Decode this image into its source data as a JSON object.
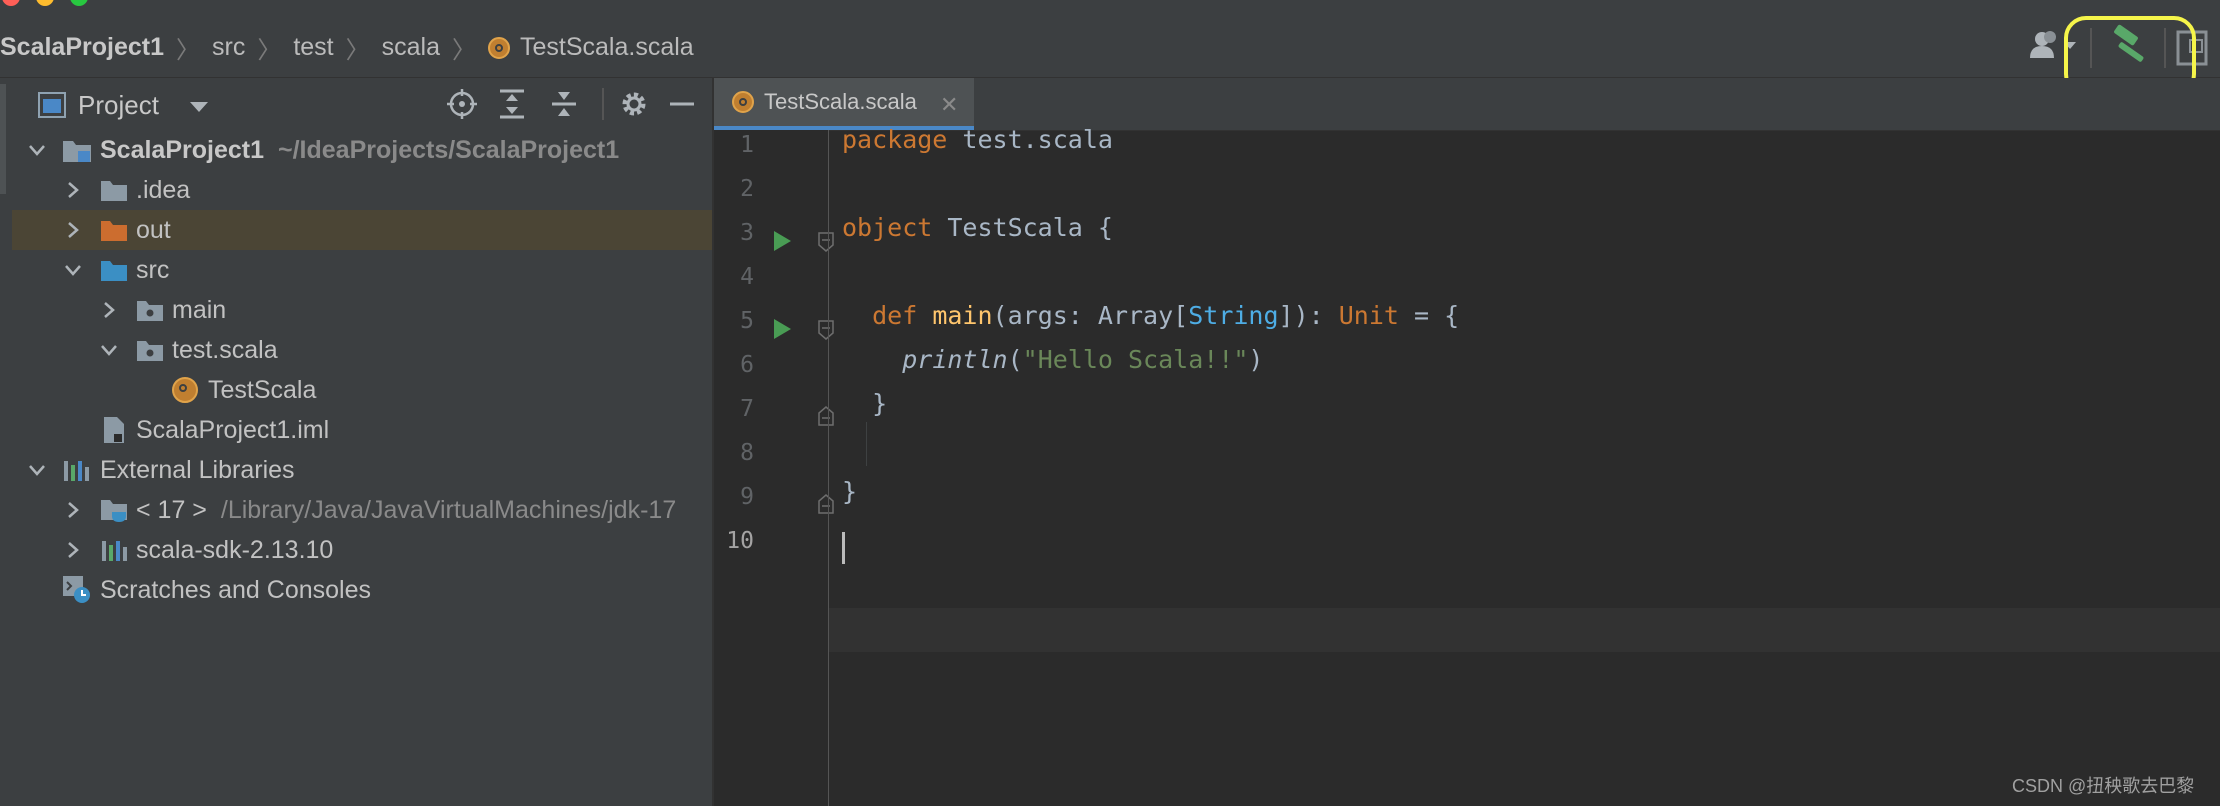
{
  "window": {
    "breadcrumb": [
      "ScalaProject1",
      "src",
      "test",
      "scala",
      "TestScala.scala"
    ]
  },
  "colors": {
    "highlight_ring": "#f6f54a",
    "build_hammer": "#59a869",
    "run_arrow": "#499c54",
    "selected_row": "#4b4535",
    "scala_icon": "#c07f30"
  },
  "project_panel": {
    "title": "Project",
    "header_icons": [
      "locate-icon",
      "expand-all-icon",
      "collapse-all-icon",
      "gear-icon",
      "minimize-icon"
    ],
    "tree": [
      {
        "label": "ScalaProject1",
        "path": "~/IdeaProjects/ScalaProject1"
      },
      {
        "label": ".idea"
      },
      {
        "label": "out"
      },
      {
        "label": "src"
      },
      {
        "label": "main"
      },
      {
        "label": "test.scala"
      },
      {
        "label": "TestScala"
      },
      {
        "label": "ScalaProject1.iml"
      },
      {
        "label": "External Libraries"
      },
      {
        "label": "< 17 >",
        "path": "/Library/Java/JavaVirtualMachines/jdk-17"
      },
      {
        "label": "scala-sdk-2.13.10"
      },
      {
        "label": "Scratches and Consoles"
      }
    ]
  },
  "editor": {
    "tab_label": "TestScala.scala",
    "line_numbers": [
      "1",
      "2",
      "3",
      "4",
      "5",
      "6",
      "7",
      "8",
      "9",
      "10"
    ],
    "code": {
      "l1_kw": "package",
      "l1_rest": " test.scala",
      "l3_kw": "object",
      "l3_rest": " TestScala {",
      "l5_indent": "  ",
      "l5_kw": "def",
      "l5_sp": " ",
      "l5_fn": "main",
      "l5_a": "(args: Array[",
      "l5_type": "String",
      "l5_b": "]): ",
      "l5_unit": "Unit",
      "l5_c": " = {",
      "l6_indent": "    ",
      "l6_fn": "println",
      "l6_open": "(",
      "l6_str": "\"Hello Scala!!\"",
      "l6_close": ")",
      "l7": "  }",
      "l9": "}"
    }
  },
  "watermark": "CSDN @扭秧歌去巴黎"
}
